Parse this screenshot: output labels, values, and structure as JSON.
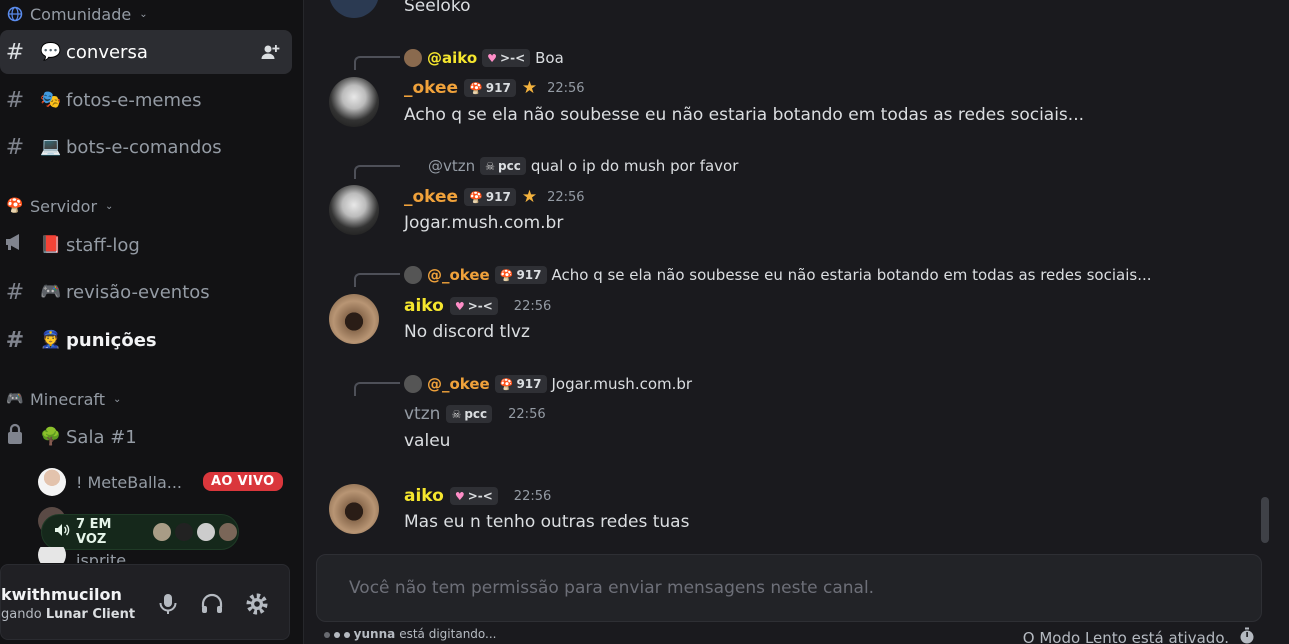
{
  "sidebar": {
    "categories": {
      "comunidade": "Comunidade",
      "servidor": "Servidor",
      "minecraft": "Minecraft"
    },
    "channels": {
      "conversa": {
        "emoji": "💬",
        "label": "conversa"
      },
      "fotos": {
        "emoji": "🎭",
        "label": "fotos-e-memes"
      },
      "bots": {
        "emoji": "💻",
        "label": "bots-e-comandos"
      },
      "staff": {
        "emoji": "📕",
        "label": "staff-log"
      },
      "revisao": {
        "emoji": "🎮",
        "label": "revisão-eventos"
      },
      "punicoes": {
        "emoji": "👮",
        "label": "punições"
      },
      "sala": {
        "emoji": "🌳",
        "label": "Sala #1"
      }
    },
    "voice": {
      "user1": "! MeteBalla...",
      "live_badge": "AO VIVO",
      "pill_label": "7 EM VOZ",
      "user3": "isprite"
    },
    "user_panel": {
      "name": "kwithmucilon",
      "status_prefix": "gando",
      "status_app": "Lunar Client"
    }
  },
  "messages": {
    "top_text": "Seeloko",
    "m1": {
      "reply_name": "@aiko",
      "reply_tag": ">-<",
      "reply_text": "Boa",
      "author": "_okee",
      "tag": "917",
      "time": "22:56",
      "text": "Acho q  se ela não soubesse eu não estaria botando em todas as redes sociais..."
    },
    "m2": {
      "reply_name": "@vtzn",
      "reply_tag": "pcc",
      "reply_text": "qual o ip do mush por favor",
      "author": "_okee",
      "tag": "917",
      "time": "22:56",
      "text": "Jogar.mush.com.br"
    },
    "m3": {
      "reply_name": "@_okee",
      "reply_tag": "917",
      "reply_text": "Acho q  se ela não soubesse eu não estaria botando em todas as redes sociais...",
      "author": "aiko",
      "tag": ">-<",
      "time": "22:56",
      "text": "No discord tlvz"
    },
    "m4": {
      "reply_name": "@_okee",
      "reply_tag": "917",
      "reply_text": "Jogar.mush.com.br",
      "author": "vtzn",
      "tag": "pcc",
      "time": "22:56",
      "text": "valeu"
    },
    "m5": {
      "author": "aiko",
      "tag": ">-<",
      "time": "22:56",
      "text": "Mas eu n tenho outras redes tuas"
    }
  },
  "composer": {
    "placeholder": "Você não tem permissão para enviar mensagens neste canal.",
    "typing_user": "yunna",
    "typing_suffix": "está digitando...",
    "slowmode": "O Modo Lento está ativado."
  },
  "colors": {
    "okee": "#f0a23b",
    "aiko": "#f5e62e",
    "vtzn": "#949ba4"
  }
}
